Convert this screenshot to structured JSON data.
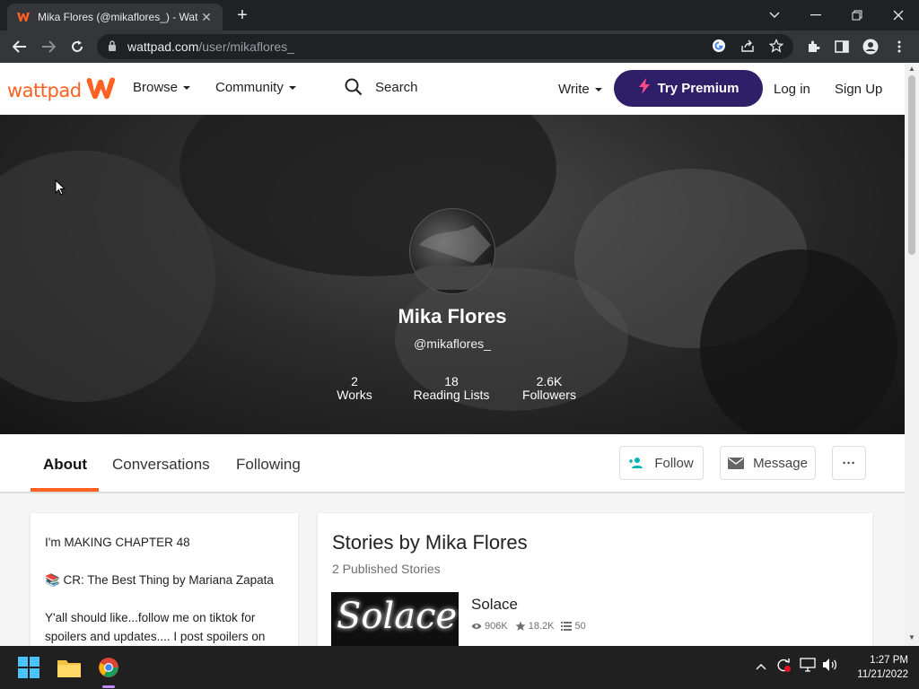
{
  "browser": {
    "tab_title": "Mika Flores (@mikaflores_) - Wat",
    "close_glyph": "✕",
    "new_tab_glyph": "+",
    "url_domain": "wattpad.com",
    "url_path": "/user/mikaflores_"
  },
  "site": {
    "logo_text": "wattpad",
    "nav": {
      "browse": "Browse",
      "community": "Community",
      "search": "Search",
      "write": "Write",
      "try_premium": "Try Premium",
      "login": "Log in",
      "signup": "Sign Up"
    },
    "brand_color": "#ff6122",
    "premium_color": "#2f1f68"
  },
  "profile": {
    "name": "Mika Flores",
    "handle": "@mikaflores_",
    "stats": [
      {
        "value": "2",
        "label": "Works"
      },
      {
        "value": "18",
        "label": "Reading Lists"
      },
      {
        "value": "2.6K",
        "label": "Followers"
      }
    ]
  },
  "tabs": {
    "about": "About",
    "conversations": "Conversations",
    "following": "Following",
    "follow": "Follow",
    "message": "Message",
    "more": "···"
  },
  "about": {
    "lines": [
      "I'm MAKING CHAPTER 48",
      "📚 CR: The Best Thing by Mariana Zapata",
      "Y'all should like...follow me on tiktok for spoilers and updates.... I post spoilers on"
    ]
  },
  "stories": {
    "heading": "Stories by Mika Flores",
    "subheading": "2 Published Stories",
    "items": [
      {
        "cover_text": "Solace",
        "title": "Solace",
        "reads": "906K",
        "votes": "18.2K",
        "parts": "50"
      }
    ]
  },
  "taskbar": {
    "time": "1:27 PM",
    "date": "11/21/2022"
  }
}
